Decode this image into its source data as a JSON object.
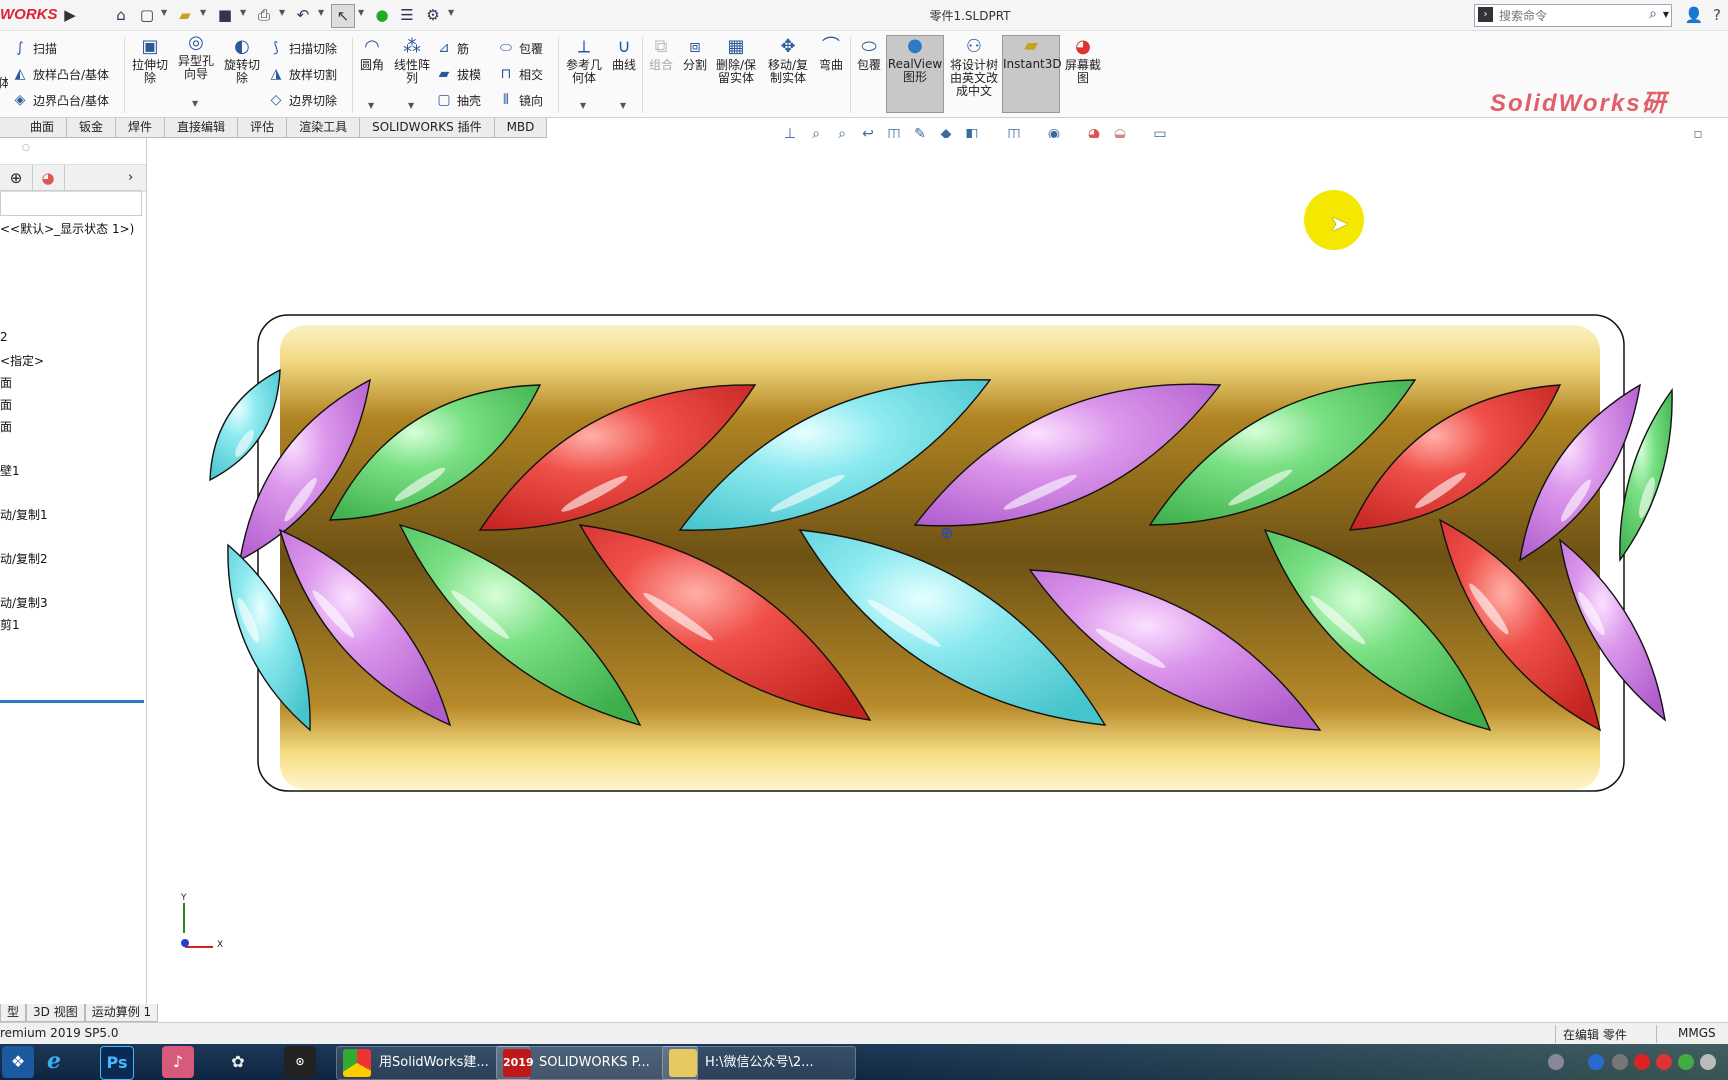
{
  "app": {
    "logo": "WORKS",
    "doc_title": "零件1.SLDPRT",
    "brand_watermark": "SolidWorks研",
    "search_placeholder": "搜索命令"
  },
  "ribbon": {
    "sweep": "扫描",
    "loft_boss": "放样凸台/基体",
    "boundary_boss": "边界凸台/基体",
    "left_cut": "体",
    "extrude_cut": "拉伸切\n除",
    "hole_wizard": "异型孔\n向导",
    "revolve_cut": "旋转切\n除",
    "swept_cut": "扫描切除",
    "lofted_cut": "放样切割",
    "boundary_cut": "边界切除",
    "fillet": "圆角",
    "linear_pattern": "线性阵\n列",
    "rib": "筋",
    "draft": "拔模",
    "shell": "抽壳",
    "wrap": "包覆",
    "intersect": "相交",
    "mirror": "镜向",
    "ref_geometry": "参考几\n何体",
    "curves": "曲线",
    "combine": "组合",
    "split": "分割",
    "delete_keep_body": "删除/保\n留实体",
    "move_copy_body": "移动/复\n制实体",
    "flex": "弯曲",
    "wrap2": "包覆",
    "realview": "RealView\n图形",
    "translate_tree": "将设计树\n由英文改\n成中文",
    "instant3d": "Instant3D",
    "screen_capture": "屏幕截\n图"
  },
  "command_tabs": [
    "曲面",
    "钣金",
    "焊件",
    "直接编辑",
    "评估",
    "渲染工具",
    "SOLIDWORKS 插件",
    "MBD"
  ],
  "tree": [
    "<<默认>_显示状态 1>)",
    "2",
    "<指定>",
    "面",
    "面",
    "面",
    "壁1",
    "动/复制1",
    "动/复制2",
    "动/复制3",
    "剪1"
  ],
  "triad": {
    "y": "Y",
    "x": "X"
  },
  "bottom_tabs": [
    "型",
    "3D 视图",
    "运动算例 1"
  ],
  "status": {
    "version": "remium 2019 SP5.0",
    "mode": "在编辑 零件",
    "units": "MMGS"
  },
  "taskbar": {
    "items": [
      "用SolidWorks建...",
      "SOLIDWORKS P...",
      "H:\\微信公众号\\2..."
    ],
    "sw_badge": "2019",
    "ps_label": "Ps"
  },
  "colors": {
    "red": "#e8423e",
    "green": "#6fd87a",
    "cyan": "#7ee6ec",
    "purple": "#d68ee8",
    "gold": "#d4a83a",
    "highlight": "#f4e800"
  }
}
